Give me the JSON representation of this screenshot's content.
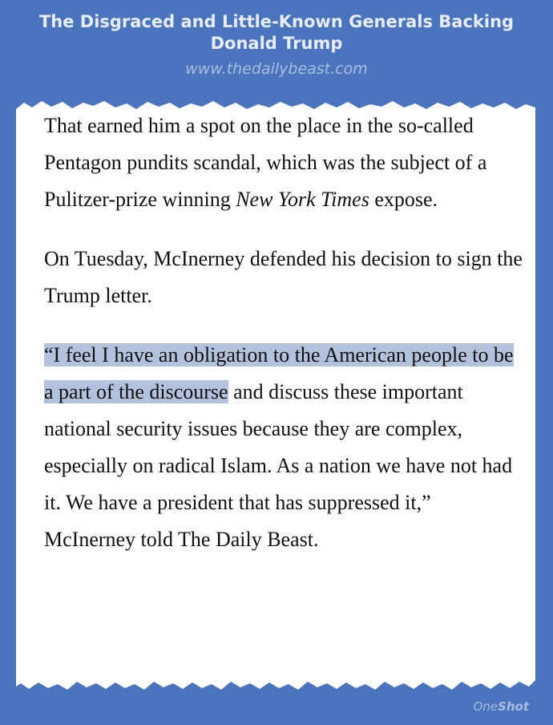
{
  "header": {
    "title": "The Disgraced and Little-Known Generals Backing Donald Trump",
    "url": "www.thedailybeast.com"
  },
  "article": {
    "p1_text": "That earned him a spot on the place in the so-called Pentagon pundits scandal, which was the subject of a Pulitzer-prize winning ",
    "p1_em": "New York Times",
    "p1_tail": " expose.",
    "p2": "On Tuesday, McInerney defended his decision to sign the Trump letter.",
    "p3_highlight": "“I feel I have an obligation to the American people to be a part of the discourse",
    "p3_rest": " and discuss these important national security issues because they are complex, especially on radical Islam. As a nation we have not had it. We have a president that has suppressed it,” McInerney told The Daily Beast."
  },
  "branding": {
    "part1": "One",
    "part2": "Shot"
  },
  "colors": {
    "background": "#4a74be",
    "paper": "#ffffff",
    "highlight": "#b3c2dc",
    "title_text": "#e7edf8",
    "url_text": "#a9bedf"
  }
}
